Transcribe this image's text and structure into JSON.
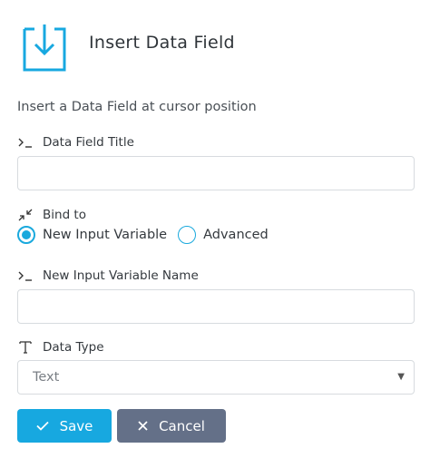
{
  "header": {
    "title": "Insert Data Field",
    "subtitle": "Insert a Data Field at cursor position",
    "icon": "download-tray-icon",
    "accent_color": "#17a8e0"
  },
  "fields": {
    "title_field": {
      "label": "Data Field Title",
      "icon": "terminal-prompt-icon",
      "value": ""
    },
    "bind_to": {
      "label": "Bind to",
      "icon": "collapse-arrows-icon",
      "options": [
        {
          "label": "New Input Variable",
          "selected": true
        },
        {
          "label": "Advanced",
          "selected": false
        }
      ]
    },
    "variable_name": {
      "label": "New Input Variable Name",
      "icon": "terminal-prompt-icon",
      "value": ""
    },
    "data_type": {
      "label": "Data Type",
      "icon": "text-type-icon",
      "selected": "Text"
    }
  },
  "buttons": {
    "save": {
      "label": "Save",
      "icon": "check-icon",
      "color": "#17a8e0"
    },
    "cancel": {
      "label": "Cancel",
      "icon": "close-icon",
      "color": "#647088"
    }
  }
}
